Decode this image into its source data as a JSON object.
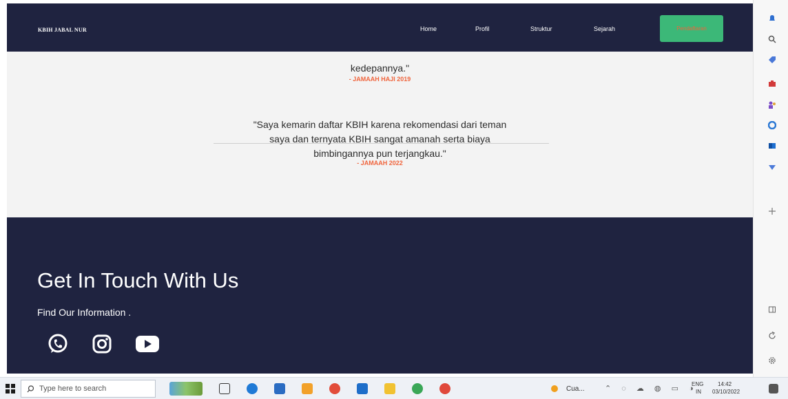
{
  "navbar": {
    "brand": "KBIH JABAL NUR",
    "links": [
      "Home",
      "Profil",
      "Struktur",
      "Sejarah"
    ],
    "cta_label": "Pendaftaran"
  },
  "testimonials": [
    {
      "quote_lines": [
        "kedepannya.\""
      ],
      "author": "- JAMAAH HAJI 2019"
    },
    {
      "quote_lines": [
        "\"Saya kemarin daftar KBIH karena rekomendasi dari teman",
        "saya dan ternyata KBIH sangat amanah serta biaya",
        "bimbingannya pun terjangkau.\""
      ],
      "author": "- JAMAAH 2022"
    }
  ],
  "footer": {
    "title": "Get In Touch With Us",
    "subtitle": "Find Our Information ."
  },
  "social_icons": [
    "whatsapp-icon",
    "instagram-icon",
    "youtube-icon"
  ],
  "taskbar": {
    "search_placeholder": "Type here to search",
    "weather": "Cua...",
    "lang_line1": "ENG",
    "lang_line2": "IN",
    "time": "14:42",
    "date": "03/10/2022"
  },
  "colors": {
    "navy": "#1f2340",
    "accent_orange": "#f0643c",
    "cta_green": "#3cb878"
  }
}
